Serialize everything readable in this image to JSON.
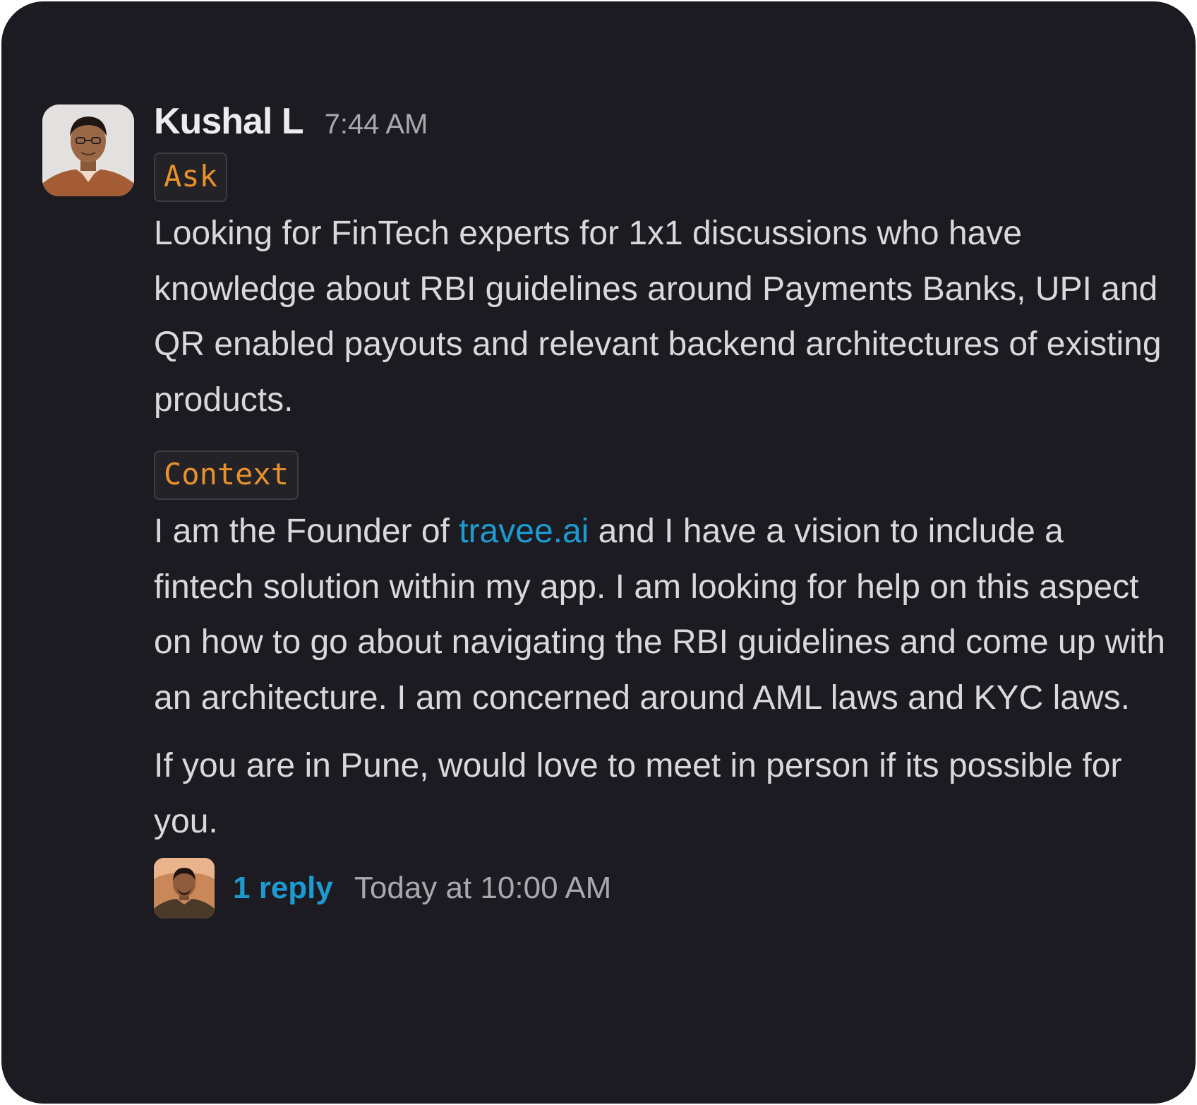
{
  "message": {
    "author": "Kushal L",
    "time": "7:44 AM",
    "avatar_icon": "user-avatar-photo",
    "ask_tag": "Ask",
    "ask_text": "Looking for FinTech experts for 1x1 discussions who have knowledge about RBI guidelines around Payments Banks, UPI and QR enabled payouts and relevant backend architectures of existing products.",
    "context_tag": "Context",
    "context_text_before_link": "I am the Founder of ",
    "context_link": "travee.ai",
    "context_text_after_link": " and I have a vision to include a fintech solution within my app. I am looking for help on this aspect on how to go about navigating the RBI guidelines and come up with an architecture. I am concerned around AML laws and KYC laws.",
    "closing_text": "If you are in Pune, would love to meet in person if its possible for you."
  },
  "thread": {
    "reply_label": "1 reply",
    "last_reply_time": "Today at 10:00 AM",
    "replier_avatar_icon": "replier-avatar-photo"
  },
  "colors": {
    "background": "#1c1b22",
    "tag_text": "#e8912d",
    "link": "#1d9bd1",
    "text": "#d9d9db",
    "muted": "#a8a8ad"
  }
}
